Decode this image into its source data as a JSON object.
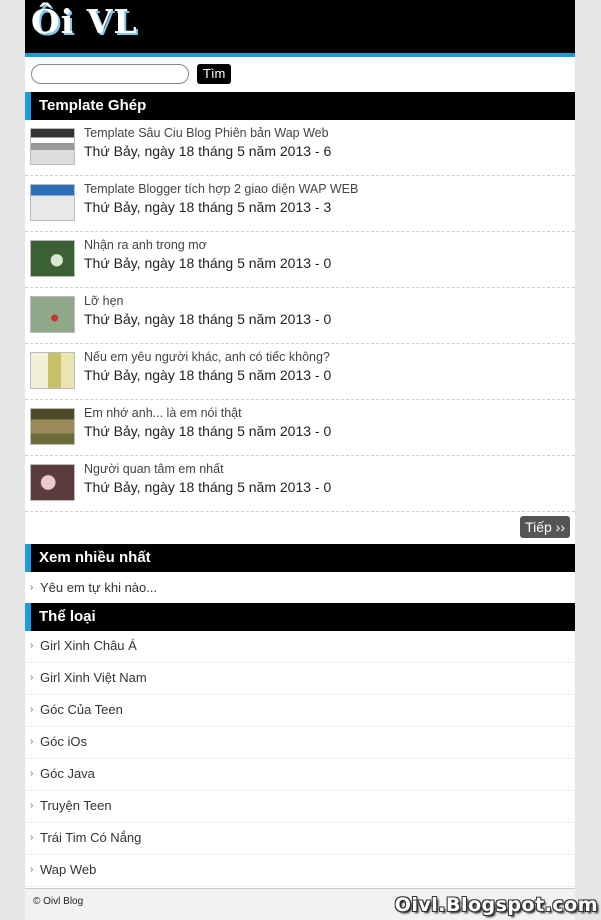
{
  "header": {
    "logo": "Ôi VL"
  },
  "search": {
    "placeholder": "",
    "button": "Tìm"
  },
  "posts_section": {
    "title": "Template Ghép",
    "posts": [
      {
        "title": "Template Sâu Ciu Blog Phiên bản Wap Web",
        "meta": "Thứ Bảy, ngày 18 tháng 5 năm 2013 - 6",
        "thumb": "blog-template-screenshot"
      },
      {
        "title": "Template Blogger tích hợp 2 giao diện WAP WEB",
        "meta": "Thứ Bảy, ngày 18 tháng 5 năm 2013 - 3",
        "thumb": "blog-template-screenshot"
      },
      {
        "title": "Nhận ra anh trong mơ",
        "meta": "Thứ Bảy, ngày 18 tháng 5 năm 2013 - 0",
        "thumb": "photo"
      },
      {
        "title": "Lỡ hẹn",
        "meta": "Thứ Bảy, ngày 18 tháng 5 năm 2013 - 0",
        "thumb": "photo"
      },
      {
        "title": "Nếu em yêu người khác, anh có tiếc không?",
        "meta": "Thứ Bảy, ngày 18 tháng 5 năm 2013 - 0",
        "thumb": "photo"
      },
      {
        "title": "Em nhớ anh... là em nói thật",
        "meta": "Thứ Bảy, ngày 18 tháng 5 năm 2013 - 0",
        "thumb": "photo"
      },
      {
        "title": "Người quan tâm em nhất",
        "meta": "Thứ Bảy, ngày 18 tháng 5 năm 2013 - 0",
        "thumb": "photo"
      }
    ],
    "more_button": "Tiếp ››"
  },
  "popular_section": {
    "title": "Xem nhiều nhất",
    "items": [
      "Yêu em tự khi nào..."
    ]
  },
  "categories_section": {
    "title": "Thể loại",
    "items": [
      "Girl Xinh Châu Á",
      "Girl Xinh Việt Nam",
      "Góc Của Teen",
      "Góc iOs",
      "Góc Java",
      "Truyện Teen",
      "Trái Tim Có Nắng",
      "Wap Web"
    ]
  },
  "footer": {
    "copyright": "© Oivl Blog",
    "watermark": "Oivl.Blogspot.com"
  },
  "colors": {
    "accent": "#1e9bdc",
    "header_bg": "#000000",
    "page_bg": "#e6e6e6"
  }
}
